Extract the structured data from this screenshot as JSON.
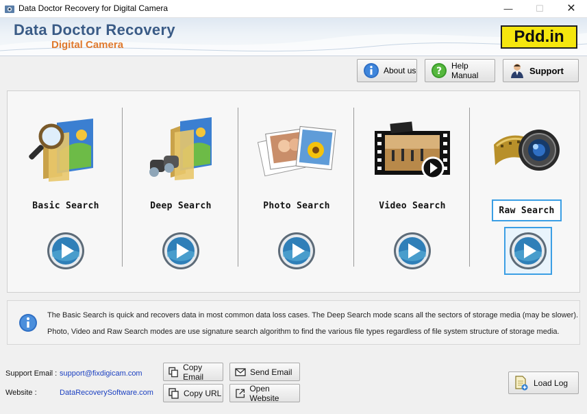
{
  "window": {
    "title": "Data Doctor Recovery for Digital Camera"
  },
  "banner": {
    "title": "Data Doctor Recovery",
    "subtitle": "Digital Camera",
    "brand": "Pdd.in"
  },
  "toolbar": {
    "about": "About us",
    "help": "Help Manual",
    "support": "Support"
  },
  "modes": [
    {
      "label": "Basic Search",
      "icon": "folder-magnifier-icon"
    },
    {
      "label": "Deep Search",
      "icon": "folder-binoculars-icon"
    },
    {
      "label": "Photo Search",
      "icon": "photos-icon"
    },
    {
      "label": "Video Search",
      "icon": "film-strip-icon"
    },
    {
      "label": "Raw Search",
      "icon": "camera-lens-film-icon",
      "selected": true
    }
  ],
  "info": {
    "line1": "The Basic Search is quick and recovers data in most common data loss cases. The Deep Search mode scans all the sectors of storage media (may be slower).",
    "line2": "Photo, Video and Raw Search modes are use signature search algorithm to find the various file types regardless of file system structure of storage media."
  },
  "footer": {
    "email_label": "Support Email :",
    "email": "support@fixdigicam.com",
    "website_label": "Website :",
    "website": "DataRecoverySoftware.com",
    "copy_email": "Copy Email",
    "send_email": "Send Email",
    "copy_url": "Copy URL",
    "open_website": "Open Website",
    "load_log": "Load Log"
  },
  "colors": {
    "accent_title": "#3a5b86",
    "accent_subtitle": "#e07a2e",
    "brand_bg": "#f5e60e",
    "selection": "#3a9ee4"
  }
}
